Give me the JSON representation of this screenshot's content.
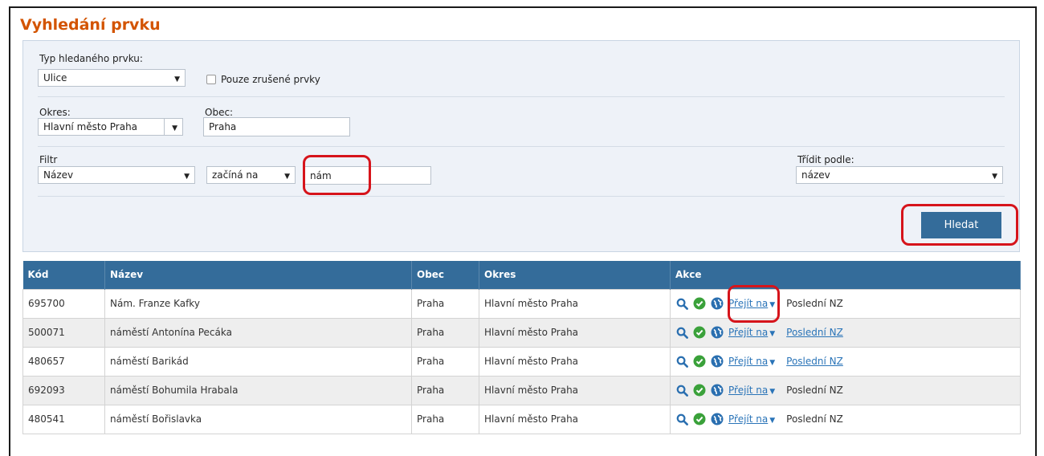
{
  "page": {
    "title": "Vyhledání prvku"
  },
  "search": {
    "type_label": "Typ hledaného prvku:",
    "type_value": "Ulice",
    "cancelled_only_label": "Pouze zrušené prvky",
    "okres_label": "Okres:",
    "okres_value": "Hlavní město Praha",
    "obec_label": "Obec:",
    "obec_value": "Praha",
    "filter_label": "Filtr",
    "filter_field_value": "Název",
    "filter_op_value": "začíná na",
    "filter_text_value": "nám",
    "sort_label": "Třídit podle:",
    "sort_value": "název",
    "search_button": "Hledat"
  },
  "table": {
    "headers": [
      "Kód",
      "Název",
      "Obec",
      "Okres",
      "Akce"
    ],
    "rows": [
      {
        "kod": "695700",
        "nazev": "Nám. Franze Kafky",
        "obec": "Praha",
        "okres": "Hlavní město Praha",
        "goto": "Přejít na",
        "last": "Poslední NZ",
        "last_link": false
      },
      {
        "kod": "500071",
        "nazev": "náměstí Antonína Pecáka",
        "obec": "Praha",
        "okres": "Hlavní město Praha",
        "goto": "Přejít na",
        "last": "Poslední NZ",
        "last_link": true
      },
      {
        "kod": "480657",
        "nazev": "náměstí Barikád",
        "obec": "Praha",
        "okres": "Hlavní město Praha",
        "goto": "Přejít na",
        "last": "Poslední NZ",
        "last_link": true
      },
      {
        "kod": "692093",
        "nazev": "náměstí Bohumila Hrabala",
        "obec": "Praha",
        "okres": "Hlavní město Praha",
        "goto": "Přejít na",
        "last": "Poslední NZ",
        "last_link": false
      },
      {
        "kod": "480541",
        "nazev": "náměstí Bořislavka",
        "obec": "Praha",
        "okres": "Hlavní město Praha",
        "goto": "Přejít na",
        "last": "Poslední NZ",
        "last_link": false
      }
    ]
  },
  "icons": {
    "detail": "search-icon",
    "valid": "check-circle-icon",
    "map": "globe-icon",
    "dropdown": "caret-down-icon"
  },
  "colors": {
    "title": "#d35400",
    "header": "#346c9a",
    "button": "#346c9a",
    "link": "#2a74b8",
    "valid_icon": "#3aa13a",
    "annotation": "#d6141b"
  }
}
